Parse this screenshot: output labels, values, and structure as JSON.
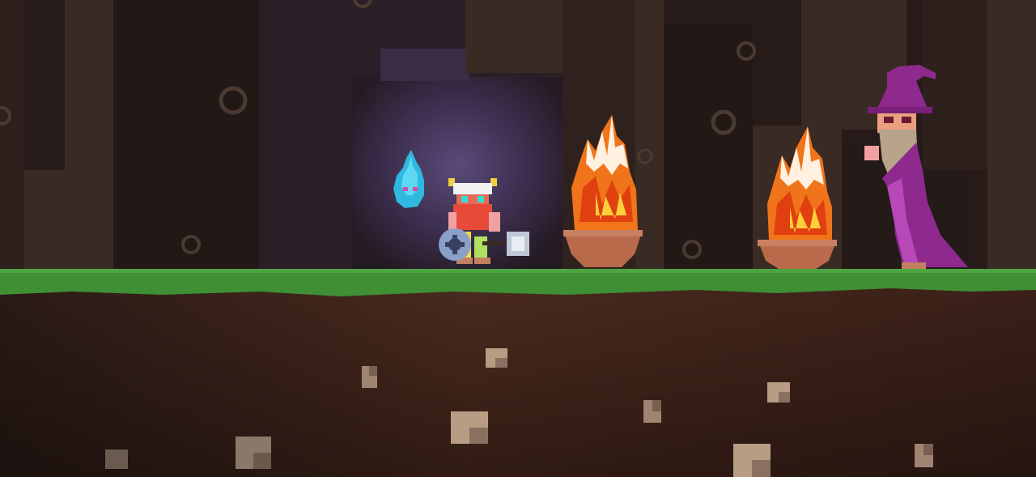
{
  "game": {
    "title": "",
    "hud": {}
  },
  "colors": {
    "cave_dark": "#221816",
    "cave_wall": "#3a2a24",
    "portal_glow": "#4a3c6a",
    "grass": "#3f8f35",
    "grass_dark": "#2f6e2a",
    "dirt": "#4a2a1e",
    "dirt_dark": "#2a1814",
    "fire_orange": "#f0741a",
    "fire_yellow": "#ffcf3a",
    "bowl": "#b86a4a",
    "wizard_purple": "#8e2a8e",
    "spirit_blue": "#2fb8e0",
    "stone": "#b89c84"
  },
  "entities": {
    "player": {
      "name": "viking-dwarf",
      "icon": "viking-icon"
    },
    "companion": {
      "name": "blue-spirit",
      "icon": "spirit-icon"
    },
    "braziers": [
      {
        "name": "fire-brazier-1",
        "icon": "fire-icon"
      },
      {
        "name": "fire-brazier-2",
        "icon": "fire-icon"
      }
    ],
    "npc": {
      "name": "purple-wizard",
      "icon": "wizard-icon"
    }
  }
}
